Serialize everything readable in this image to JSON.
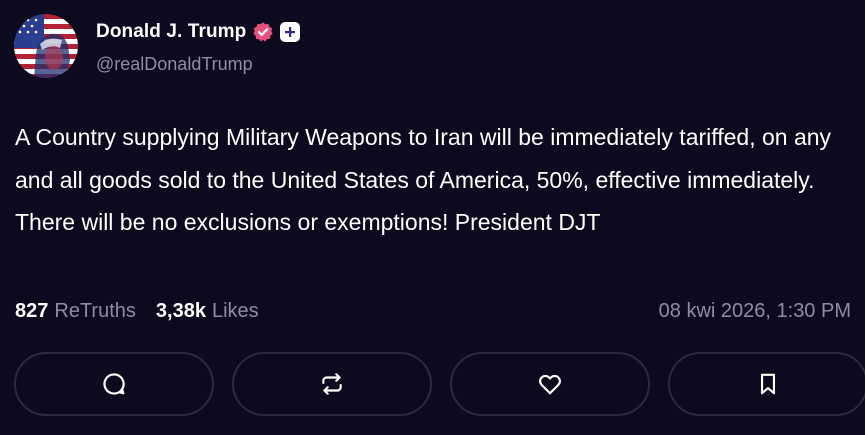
{
  "post": {
    "author": {
      "display_name": "Donald J. Trump",
      "handle": "@realDonaldTrump",
      "verified_icon": "verified-badge-icon",
      "plus_icon": "plus-icon"
    },
    "content": "A Country supplying Military Weapons to Iran will be immediately tariffed, on any and all goods sold to the United States of America, 50%, effective immediately. There will be no exclusions or exemptions! President DJT",
    "stats": {
      "retruths_count": "827",
      "retruths_label": "ReTruths",
      "likes_count": "3,38k",
      "likes_label": "Likes",
      "timestamp": "08 kwi 2026, 1:30 PM"
    },
    "actions": [
      {
        "icon": "reply-icon"
      },
      {
        "icon": "retruth-icon"
      },
      {
        "icon": "like-icon"
      },
      {
        "icon": "bookmark-icon"
      }
    ]
  },
  "colors": {
    "background": "#0c0a1e",
    "muted_text": "#8f8ca6",
    "verified": "#e5527e",
    "button_border": "#2c2942"
  }
}
